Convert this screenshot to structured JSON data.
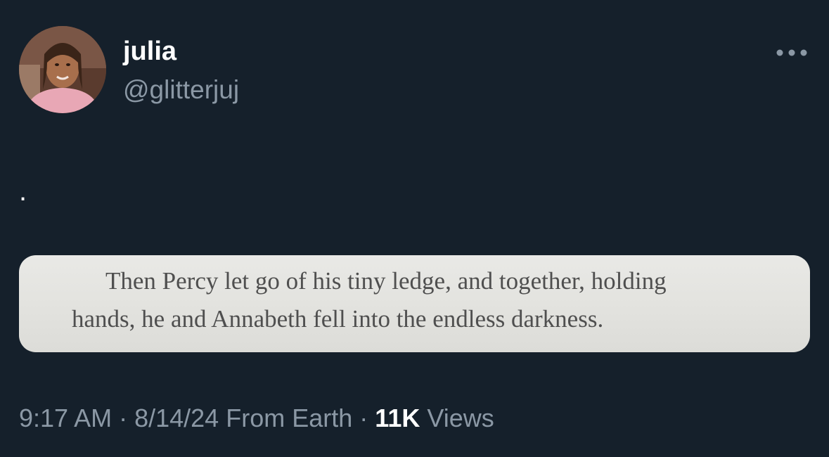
{
  "author": {
    "display_name": "julia",
    "handle": "@glitterjuj",
    "avatar_icon": "profile-photo"
  },
  "tweet": {
    "text": "."
  },
  "media": {
    "lines": [
      "Then Percy let go of his tiny ledge, and together, holding",
      "hands, he and Annabeth fell into the endless darkness."
    ]
  },
  "meta": {
    "time": "9:17 AM",
    "separator": " · ",
    "date": "8/14/24",
    "source": "From Earth",
    "views_count": "11K",
    "views_label": "Views"
  },
  "menu": {
    "icon": "more-horizontal-icon"
  },
  "colors": {
    "background": "#15202b",
    "primary_text": "#ffffff",
    "secondary_text": "#8b98a5"
  }
}
